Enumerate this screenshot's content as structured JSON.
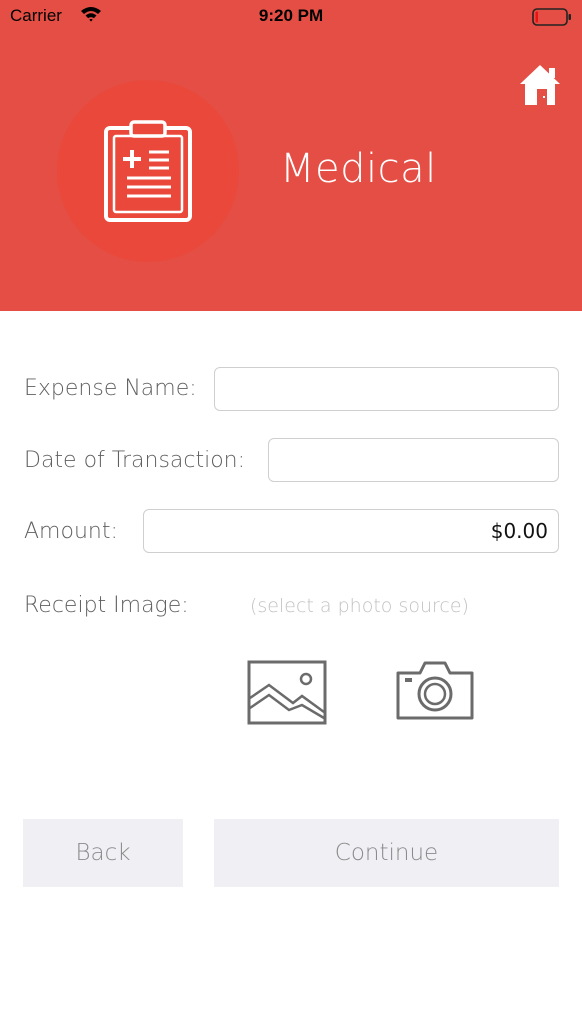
{
  "status_bar": {
    "carrier": "Carrier",
    "time": "9:20 PM",
    "icons": [
      "wifi-icon",
      "battery-icon"
    ]
  },
  "header": {
    "title": "Medical",
    "category_icon": "clipboard-icon",
    "home_icon": "home-icon",
    "background_color": "#e44e44"
  },
  "form": {
    "expense_name_label": "Expense Name:",
    "expense_name_value": "",
    "date_label": "Date of Transaction:",
    "date_value": "",
    "amount_label": "Amount:",
    "amount_value": "$0.00",
    "receipt_label": "Receipt Image:",
    "receipt_hint": "(select a photo source)",
    "photo_sources": [
      "photo-library-icon",
      "camera-icon"
    ]
  },
  "buttons": {
    "back_label": "Back",
    "continue_label": "Continue"
  }
}
